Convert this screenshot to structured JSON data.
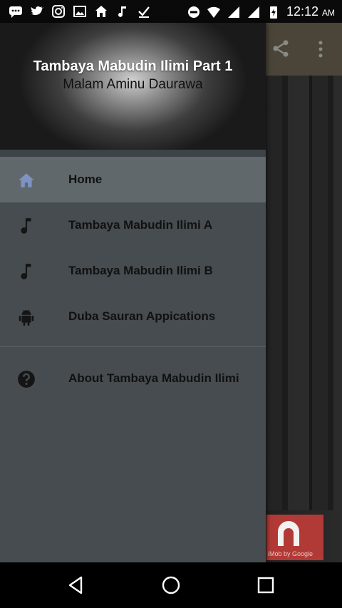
{
  "status_bar": {
    "time": "12:12",
    "ampm": "AM",
    "left_icons": [
      "chat-icon",
      "twitter-icon",
      "instagram-icon",
      "image-icon",
      "home-icon",
      "music-icon",
      "download-check-icon"
    ],
    "right_icons": [
      "dnd-icon",
      "wifi-icon",
      "signal-icon",
      "signal-icon",
      "battery-charging-icon"
    ]
  },
  "drawer": {
    "header": {
      "title": "Tambaya Mabudin Ilimi Part 1",
      "subtitle": "Malam Aminu Daurawa"
    },
    "items": [
      {
        "label": "Home",
        "icon": "home-icon",
        "active": true
      },
      {
        "label": "Tambaya Mabudin Ilimi A",
        "icon": "music-note-icon"
      },
      {
        "label": "Tambaya Mabudin Ilimi B",
        "icon": "music-note-icon"
      },
      {
        "label": "Duba Sauran Appications",
        "icon": "android-icon"
      }
    ],
    "secondary_items": [
      {
        "label": "About Tambaya Mabudin Ilimi",
        "icon": "help-icon"
      }
    ]
  },
  "toolbar": {
    "share_icon": "share-icon",
    "overflow_icon": "more-vert-icon"
  },
  "ad": {
    "text": "iMob by Google"
  },
  "colors": {
    "drawer_bg": "#464c4f",
    "active_item_bg": "#61686b",
    "home_icon": "#7e93c4",
    "ad_bg": "#b23a36"
  }
}
